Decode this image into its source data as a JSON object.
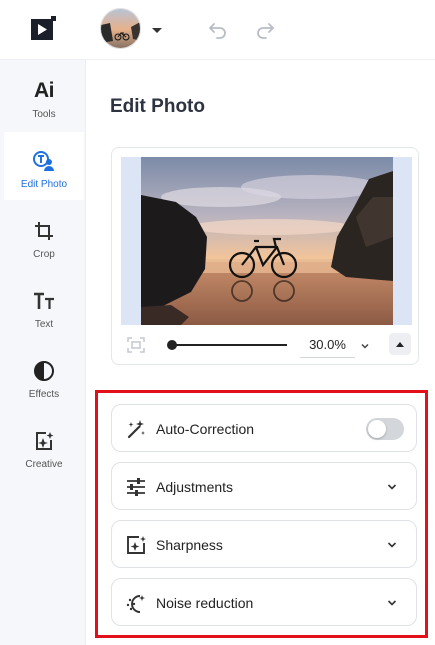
{
  "header": {
    "logo_icon": "play-logo-icon",
    "avatar": "user-avatar",
    "undo_icon": "undo-icon",
    "redo_icon": "redo-icon"
  },
  "sidebar": {
    "active": "Edit Photo",
    "accent_color": "#1e6fe0",
    "items": [
      {
        "label": "Tools",
        "icon": "ai-tools-icon"
      },
      {
        "label": "Edit Photo",
        "icon": "edit-photo-icon"
      },
      {
        "label": "Crop",
        "icon": "crop-icon"
      },
      {
        "label": "Text",
        "icon": "text-icon"
      },
      {
        "label": "Effects",
        "icon": "effects-icon"
      },
      {
        "label": "Creative",
        "icon": "creative-icon"
      }
    ]
  },
  "main": {
    "title": "Edit Photo",
    "preview": {
      "image": "beach-sunset-bicycle-photo",
      "zoom_value": "30.0%",
      "zoom_fraction": 0.0
    },
    "panel": {
      "highlight_color": "#e30f1b",
      "auto_correction": {
        "label": "Auto-Correction",
        "enabled": false,
        "icon": "magic-wand-icon"
      },
      "sections": [
        {
          "label": "Adjustments",
          "icon": "sliders-icon"
        },
        {
          "label": "Sharpness",
          "icon": "sharpness-icon"
        },
        {
          "label": "Noise reduction",
          "icon": "noise-reduction-icon"
        }
      ]
    }
  }
}
